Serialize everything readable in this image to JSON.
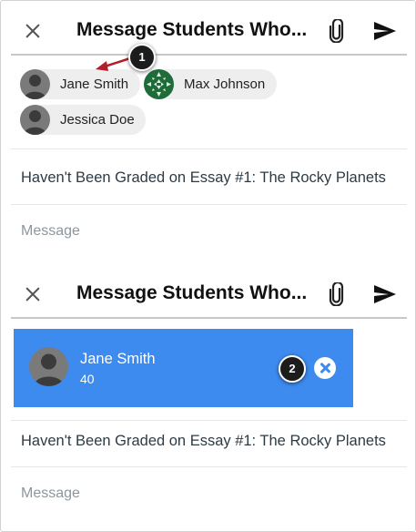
{
  "panel1": {
    "title": "Message Students Who...",
    "recipients": [
      {
        "name": "Jane Smith",
        "avatar": "person-placeholder"
      },
      {
        "name": "Max Johnson",
        "avatar": "green-pattern-avatar"
      },
      {
        "name": "Jessica Doe",
        "avatar": "person-placeholder"
      }
    ],
    "subject": "Haven't Been Graded on Essay #1: The Rocky Planets",
    "message_placeholder": "Message"
  },
  "panel2": {
    "title": "Message Students Who...",
    "selected_recipient": {
      "name": "Jane Smith",
      "score": "40"
    },
    "subject": "Haven't Been Graded on Essay #1: The Rocky Planets",
    "message_placeholder": "Message"
  },
  "callouts": [
    "1",
    "2"
  ],
  "icons": {
    "close": "close-icon",
    "attach": "paperclip-icon",
    "send": "send-icon",
    "remove": "remove-circle-icon"
  },
  "colors": {
    "accent": "#3e8bf0",
    "arrow": "#b0202a",
    "callout": "#1c1c1c"
  }
}
